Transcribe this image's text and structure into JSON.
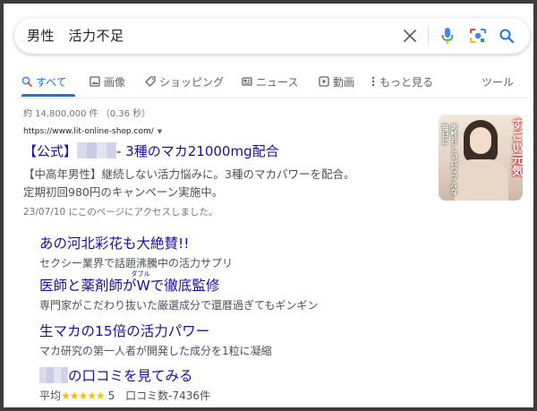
{
  "search": {
    "query": "男性　活力不足"
  },
  "tabs": [
    {
      "label": "すべて",
      "icon": "search-icon",
      "active": true
    },
    {
      "label": "画像",
      "icon": "image-icon"
    },
    {
      "label": "ショッピング",
      "icon": "tag-icon"
    },
    {
      "label": "ニュース",
      "icon": "news-icon"
    },
    {
      "label": "動画",
      "icon": "video-icon"
    },
    {
      "label": "もっと見る",
      "icon": "more-vert-icon"
    },
    {
      "label": "ツール"
    }
  ],
  "stats": "約 14,800,000 件 （0.36 秒）",
  "ad": {
    "url": "https://www.lit-online-shop.com/",
    "title_prefix": "【公式】",
    "title_suffix": "- 3種のマカ21000mg配合",
    "desc_line1": "【中高年男性】継続しない活力悩みに。3種のマカパワーを配合。",
    "desc_line2": "定期初回980円のキャンペーン実施中。",
    "visited": "23/07/10 にこのページにアクセスしました。"
  },
  "thumbnail": {
    "headline": "すごい元気",
    "side_text": "男性らしいパワフルな毎日に"
  },
  "sitelinks": [
    {
      "title": "あの河北彩花も大絶賛!!",
      "desc": "セクシー業界で話題沸騰中の活力サプリ"
    },
    {
      "title_a": "医師と薬剤師が",
      "title_b": "W",
      "ruby": "ダブル",
      "title_c": "で徹底監修",
      "desc": "専門家がこだわり抜いた厳選成分で還暦過ぎてもギンギン"
    },
    {
      "title": "生マカの15倍の活力パワー",
      "desc": "マカ研究の第一人者が開発した成分を1粒に凝縮"
    },
    {
      "title": "の口コミを見てみる",
      "rating_prefix": "平均",
      "stars": "★★★★★",
      "rating_value": "5",
      "review_count": "口コミ数-7436件"
    }
  ],
  "colors": {
    "link": "#1a0dab",
    "accent": "#1a73e8",
    "star": "#fbbc04"
  }
}
